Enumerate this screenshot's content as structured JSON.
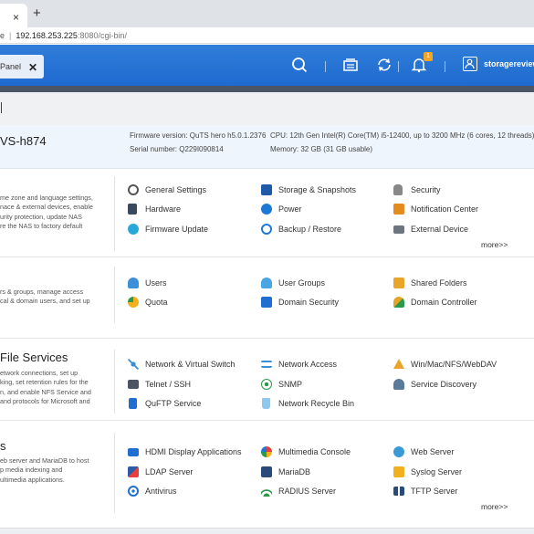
{
  "browser": {
    "tab_close": "×",
    "new_tab": "+",
    "address_prefix": "e",
    "address_host": "192.168.253.225",
    "address_path": ":8080/cgi-bin/"
  },
  "header": {
    "tab_label": "Panel",
    "tab_close": "✕",
    "notification_count": "1",
    "username": "storagereview"
  },
  "system": {
    "model": "VS-h874",
    "firmware": "Firmware version:  QuTS hero h5.0.1.2376",
    "serial": "Serial number:  Q229I090814",
    "cpu": "CPU:  12th Gen Intel(R) Core(TM) i5-12400, up to 3200 MHz (6 cores, 12 threads)",
    "memory": "Memory:  32 GB (31 GB usable)"
  },
  "sections": {
    "system": {
      "desc": [
        "me zone and language settings,",
        "nace & external devices, enable",
        "urity protection, update NAS",
        "re the NAS to factory default"
      ],
      "items": [
        "General Settings",
        "Storage & Snapshots",
        "Security",
        "Hardware",
        "Power",
        "Notification Center",
        "Firmware Update",
        "Backup / Restore",
        "External Device"
      ],
      "more": "more>>"
    },
    "privilege": {
      "desc": [
        "rs & groups, manage access",
        "cal & domain users, and set up"
      ],
      "items": [
        "Users",
        "User Groups",
        "Shared Folders",
        "Quota",
        "Domain Security",
        "Domain Controller"
      ]
    },
    "network": {
      "title": "File Services",
      "desc": [
        "etwork connections, set up",
        "king, set retention rules for the",
        "n, and enable NFS Service and",
        "and protocols for Microsoft and"
      ],
      "items": [
        "Network & Virtual Switch",
        "Network Access",
        "Win/Mac/NFS/WebDAV",
        "Telnet / SSH",
        "SNMP",
        "Service Discovery",
        "QuFTP Service",
        "Network Recycle Bin"
      ]
    },
    "applications": {
      "title": "s",
      "desc": [
        "eb server and MariaDB to host",
        "p media indexing and",
        "ultimedia applications."
      ],
      "items": [
        "HDMI Display Applications",
        "Multimedia Console",
        "Web Server",
        "LDAP Server",
        "MariaDB",
        "Syslog Server",
        "Antivirus",
        "RADIUS Server",
        "TFTP Server"
      ],
      "more": "more>>"
    }
  },
  "colors": {
    "header_blue": "#2476d6",
    "accent": "#f4a623"
  }
}
